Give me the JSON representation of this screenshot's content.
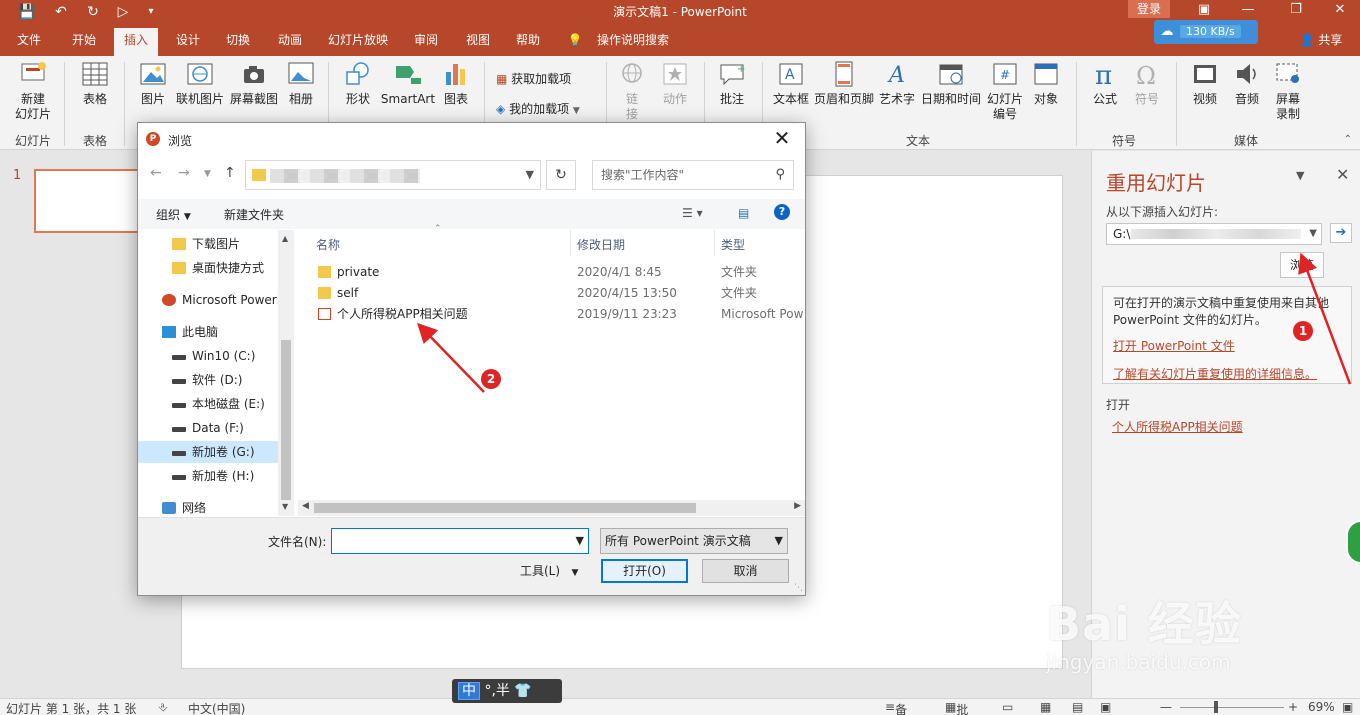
{
  "titlebar": {
    "title": "演示文稿1  -  PowerPoint",
    "login": "登录"
  },
  "tabs": [
    "文件",
    "开始",
    "插入",
    "设计",
    "切换",
    "动画",
    "幻灯片放映",
    "审阅",
    "视图",
    "帮助",
    "操作说明搜索"
  ],
  "active_tab": "插入",
  "share": "共享",
  "net_speed": "130 KB/s",
  "ribbon": {
    "new_slide": "新建\n幻灯片",
    "table": "表格",
    "picture": "图片",
    "online_picture": "联机图片",
    "screenshot": "屏幕截图",
    "album": "相册",
    "shapes": "形状",
    "smartart": "SmartArt",
    "chart": "图表",
    "get_addins": "获取加载项",
    "my_addins": "我的加载项",
    "link": "链\n接",
    "action": "动作",
    "comment": "批注",
    "textbox": "文本框",
    "header_footer": "页眉和页脚",
    "wordart": "艺术字",
    "datetime": "日期和时间",
    "slide_number": "幻灯片\n编号",
    "object": "对象",
    "equation": "公式",
    "symbol": "符号",
    "video": "视频",
    "audio": "音频",
    "screen_record": "屏幕\n录制",
    "groups": {
      "slides": "幻灯片",
      "tables": "表格",
      "text": "文本",
      "symbols": "符号",
      "media": "媒体"
    }
  },
  "slide_panel": {
    "slide_number": "1"
  },
  "reuse_pane": {
    "title": "重用幻灯片",
    "source_label": "从以下源插入幻灯片:",
    "source_value": "G:\\",
    "browse": "浏览",
    "info_text": "可在打开的演示文稿中重复使用来自其他 PowerPoint 文件的幻灯片。",
    "open_pptx_link": "打开 PowerPoint 文件",
    "learn_more_link": "了解有关幻灯片重复使用的详细信息。",
    "open_label": "打开",
    "recent_file": "个人所得税APP相关问题"
  },
  "dialog": {
    "title": "浏览",
    "search_placeholder": "搜索\"工作内容\"",
    "organize": "组织",
    "new_folder": "新建文件夹",
    "nav_items": [
      {
        "label": "下载图片",
        "type": "folder"
      },
      {
        "label": "桌面快捷方式",
        "type": "folder"
      },
      {
        "label": "Microsoft PowerPoint",
        "type": "ppt"
      },
      {
        "label": "此电脑",
        "type": "pc"
      },
      {
        "label": "Win10 (C:)",
        "type": "drive"
      },
      {
        "label": "软件 (D:)",
        "type": "drive"
      },
      {
        "label": "本地磁盘 (E:)",
        "type": "drive"
      },
      {
        "label": "Data (F:)",
        "type": "drive"
      },
      {
        "label": "新加卷 (G:)",
        "type": "drive"
      },
      {
        "label": "新加卷 (H:)",
        "type": "drive"
      },
      {
        "label": "网络",
        "type": "net"
      }
    ],
    "columns": [
      "名称",
      "修改日期",
      "类型"
    ],
    "files": [
      {
        "name": "private",
        "date": "2020/4/1 8:45",
        "type": "文件夹",
        "kind": "folder"
      },
      {
        "name": "self",
        "date": "2020/4/15 13:50",
        "type": "文件夹",
        "kind": "folder"
      },
      {
        "name": "个人所得税APP相关问题",
        "date": "2019/9/11 23:23",
        "type": "Microsoft Pow",
        "kind": "ppt"
      }
    ],
    "filename_label": "文件名(N):",
    "filename_value": "",
    "filter": "所有 PowerPoint 演示文稿",
    "tools": "工具(L)",
    "open": "打开(O)",
    "cancel": "取消"
  },
  "annotations": {
    "badge1": "1",
    "badge2": "2",
    "arrow_color": "#e02424"
  },
  "statusbar": {
    "slide_info": "幻灯片 第 1 张，共 1 张",
    "language": "中文(中国)",
    "notes": "备注",
    "comments": "批注",
    "zoom": "69%"
  },
  "ime": {
    "mode": "中",
    "punct": "°,半"
  },
  "watermark": {
    "brand": "Bai 经验",
    "url": "jingyan.baidu.com"
  }
}
